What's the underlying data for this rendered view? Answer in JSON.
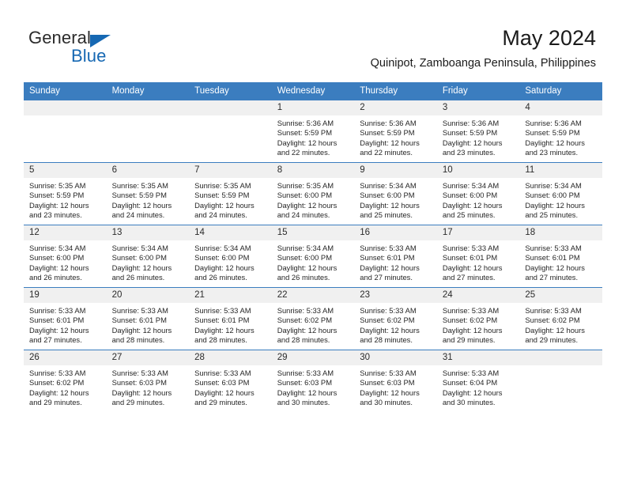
{
  "brand": {
    "name_part1": "General",
    "name_part2": "Blue",
    "triangle_icon": "triangle-icon",
    "accent_color": "#1668b3"
  },
  "header": {
    "title": "May 2024",
    "subtitle": "Quinipot, Zamboanga Peninsula, Philippines"
  },
  "calendar": {
    "header_bg": "#3b7dbf",
    "daynum_bg": "#f0f0f0",
    "weekday_headers": [
      "Sunday",
      "Monday",
      "Tuesday",
      "Wednesday",
      "Thursday",
      "Friday",
      "Saturday"
    ],
    "weeks": [
      [
        {
          "day": "",
          "empty": true,
          "sunrise": "",
          "sunset": "",
          "daylight1": "",
          "daylight2": ""
        },
        {
          "day": "",
          "empty": true,
          "sunrise": "",
          "sunset": "",
          "daylight1": "",
          "daylight2": ""
        },
        {
          "day": "",
          "empty": true,
          "sunrise": "",
          "sunset": "",
          "daylight1": "",
          "daylight2": ""
        },
        {
          "day": "1",
          "sunrise": "Sunrise: 5:36 AM",
          "sunset": "Sunset: 5:59 PM",
          "daylight1": "Daylight: 12 hours",
          "daylight2": "and 22 minutes."
        },
        {
          "day": "2",
          "sunrise": "Sunrise: 5:36 AM",
          "sunset": "Sunset: 5:59 PM",
          "daylight1": "Daylight: 12 hours",
          "daylight2": "and 22 minutes."
        },
        {
          "day": "3",
          "sunrise": "Sunrise: 5:36 AM",
          "sunset": "Sunset: 5:59 PM",
          "daylight1": "Daylight: 12 hours",
          "daylight2": "and 23 minutes."
        },
        {
          "day": "4",
          "sunrise": "Sunrise: 5:36 AM",
          "sunset": "Sunset: 5:59 PM",
          "daylight1": "Daylight: 12 hours",
          "daylight2": "and 23 minutes."
        }
      ],
      [
        {
          "day": "5",
          "sunrise": "Sunrise: 5:35 AM",
          "sunset": "Sunset: 5:59 PM",
          "daylight1": "Daylight: 12 hours",
          "daylight2": "and 23 minutes."
        },
        {
          "day": "6",
          "sunrise": "Sunrise: 5:35 AM",
          "sunset": "Sunset: 5:59 PM",
          "daylight1": "Daylight: 12 hours",
          "daylight2": "and 24 minutes."
        },
        {
          "day": "7",
          "sunrise": "Sunrise: 5:35 AM",
          "sunset": "Sunset: 5:59 PM",
          "daylight1": "Daylight: 12 hours",
          "daylight2": "and 24 minutes."
        },
        {
          "day": "8",
          "sunrise": "Sunrise: 5:35 AM",
          "sunset": "Sunset: 6:00 PM",
          "daylight1": "Daylight: 12 hours",
          "daylight2": "and 24 minutes."
        },
        {
          "day": "9",
          "sunrise": "Sunrise: 5:34 AM",
          "sunset": "Sunset: 6:00 PM",
          "daylight1": "Daylight: 12 hours",
          "daylight2": "and 25 minutes."
        },
        {
          "day": "10",
          "sunrise": "Sunrise: 5:34 AM",
          "sunset": "Sunset: 6:00 PM",
          "daylight1": "Daylight: 12 hours",
          "daylight2": "and 25 minutes."
        },
        {
          "day": "11",
          "sunrise": "Sunrise: 5:34 AM",
          "sunset": "Sunset: 6:00 PM",
          "daylight1": "Daylight: 12 hours",
          "daylight2": "and 25 minutes."
        }
      ],
      [
        {
          "day": "12",
          "sunrise": "Sunrise: 5:34 AM",
          "sunset": "Sunset: 6:00 PM",
          "daylight1": "Daylight: 12 hours",
          "daylight2": "and 26 minutes."
        },
        {
          "day": "13",
          "sunrise": "Sunrise: 5:34 AM",
          "sunset": "Sunset: 6:00 PM",
          "daylight1": "Daylight: 12 hours",
          "daylight2": "and 26 minutes."
        },
        {
          "day": "14",
          "sunrise": "Sunrise: 5:34 AM",
          "sunset": "Sunset: 6:00 PM",
          "daylight1": "Daylight: 12 hours",
          "daylight2": "and 26 minutes."
        },
        {
          "day": "15",
          "sunrise": "Sunrise: 5:34 AM",
          "sunset": "Sunset: 6:00 PM",
          "daylight1": "Daylight: 12 hours",
          "daylight2": "and 26 minutes."
        },
        {
          "day": "16",
          "sunrise": "Sunrise: 5:33 AM",
          "sunset": "Sunset: 6:01 PM",
          "daylight1": "Daylight: 12 hours",
          "daylight2": "and 27 minutes."
        },
        {
          "day": "17",
          "sunrise": "Sunrise: 5:33 AM",
          "sunset": "Sunset: 6:01 PM",
          "daylight1": "Daylight: 12 hours",
          "daylight2": "and 27 minutes."
        },
        {
          "day": "18",
          "sunrise": "Sunrise: 5:33 AM",
          "sunset": "Sunset: 6:01 PM",
          "daylight1": "Daylight: 12 hours",
          "daylight2": "and 27 minutes."
        }
      ],
      [
        {
          "day": "19",
          "sunrise": "Sunrise: 5:33 AM",
          "sunset": "Sunset: 6:01 PM",
          "daylight1": "Daylight: 12 hours",
          "daylight2": "and 27 minutes."
        },
        {
          "day": "20",
          "sunrise": "Sunrise: 5:33 AM",
          "sunset": "Sunset: 6:01 PM",
          "daylight1": "Daylight: 12 hours",
          "daylight2": "and 28 minutes."
        },
        {
          "day": "21",
          "sunrise": "Sunrise: 5:33 AM",
          "sunset": "Sunset: 6:01 PM",
          "daylight1": "Daylight: 12 hours",
          "daylight2": "and 28 minutes."
        },
        {
          "day": "22",
          "sunrise": "Sunrise: 5:33 AM",
          "sunset": "Sunset: 6:02 PM",
          "daylight1": "Daylight: 12 hours",
          "daylight2": "and 28 minutes."
        },
        {
          "day": "23",
          "sunrise": "Sunrise: 5:33 AM",
          "sunset": "Sunset: 6:02 PM",
          "daylight1": "Daylight: 12 hours",
          "daylight2": "and 28 minutes."
        },
        {
          "day": "24",
          "sunrise": "Sunrise: 5:33 AM",
          "sunset": "Sunset: 6:02 PM",
          "daylight1": "Daylight: 12 hours",
          "daylight2": "and 29 minutes."
        },
        {
          "day": "25",
          "sunrise": "Sunrise: 5:33 AM",
          "sunset": "Sunset: 6:02 PM",
          "daylight1": "Daylight: 12 hours",
          "daylight2": "and 29 minutes."
        }
      ],
      [
        {
          "day": "26",
          "sunrise": "Sunrise: 5:33 AM",
          "sunset": "Sunset: 6:02 PM",
          "daylight1": "Daylight: 12 hours",
          "daylight2": "and 29 minutes."
        },
        {
          "day": "27",
          "sunrise": "Sunrise: 5:33 AM",
          "sunset": "Sunset: 6:03 PM",
          "daylight1": "Daylight: 12 hours",
          "daylight2": "and 29 minutes."
        },
        {
          "day": "28",
          "sunrise": "Sunrise: 5:33 AM",
          "sunset": "Sunset: 6:03 PM",
          "daylight1": "Daylight: 12 hours",
          "daylight2": "and 29 minutes."
        },
        {
          "day": "29",
          "sunrise": "Sunrise: 5:33 AM",
          "sunset": "Sunset: 6:03 PM",
          "daylight1": "Daylight: 12 hours",
          "daylight2": "and 30 minutes."
        },
        {
          "day": "30",
          "sunrise": "Sunrise: 5:33 AM",
          "sunset": "Sunset: 6:03 PM",
          "daylight1": "Daylight: 12 hours",
          "daylight2": "and 30 minutes."
        },
        {
          "day": "31",
          "sunrise": "Sunrise: 5:33 AM",
          "sunset": "Sunset: 6:04 PM",
          "daylight1": "Daylight: 12 hours",
          "daylight2": "and 30 minutes."
        },
        {
          "day": "",
          "empty": true,
          "sunrise": "",
          "sunset": "",
          "daylight1": "",
          "daylight2": ""
        }
      ]
    ]
  }
}
